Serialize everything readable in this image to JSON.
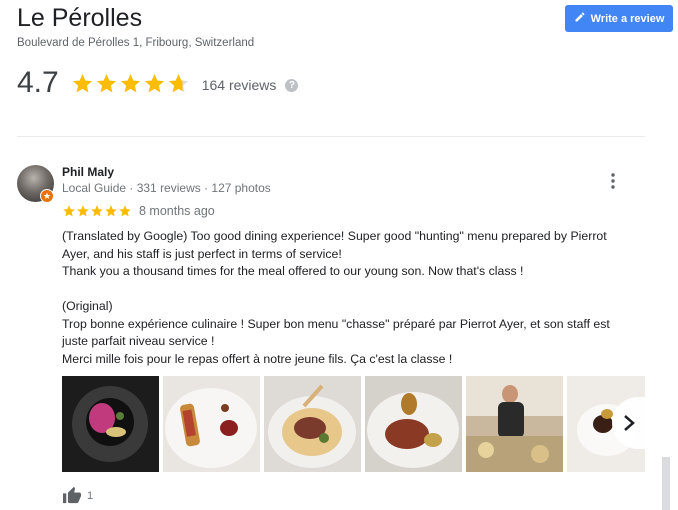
{
  "place": {
    "name": "Le Pérolles",
    "address": "Boulevard de Pérolles 1, Fribourg, Switzerland",
    "rating": "4.7",
    "stars_filled": 4.7,
    "review_count": "164 reviews"
  },
  "header": {
    "write_review_label": "Write a review",
    "write_review_icon": "pencil-icon"
  },
  "review": {
    "author": "Phil Maly",
    "author_meta": "Local Guide · 331 reviews · 127 photos",
    "stars": 5,
    "date": "8 months ago",
    "translated": [
      "(Translated by Google) Too good dining experience! Super good \"hunting\" menu prepared by Pierrot",
      "Ayer, and his staff is just perfect in terms of service!",
      "Thank you a thousand times for the meal offered to our young son. Now that's class !"
    ],
    "original_label": "(Original)",
    "original": [
      "Trop bonne expérience culinaire ! Super bon menu \"chasse\" préparé par Pierrot Ayer, et son staff est",
      "juste parfait niveau service !",
      "Merci mille fois pour le repas offert à notre jeune fils. Ça c'est la classe !"
    ],
    "like_count": "1"
  },
  "colors": {
    "accent": "#4285f4",
    "star": "#fbbc04",
    "star_empty": "#dadce0",
    "local_guide_badge": "#e8710a"
  }
}
